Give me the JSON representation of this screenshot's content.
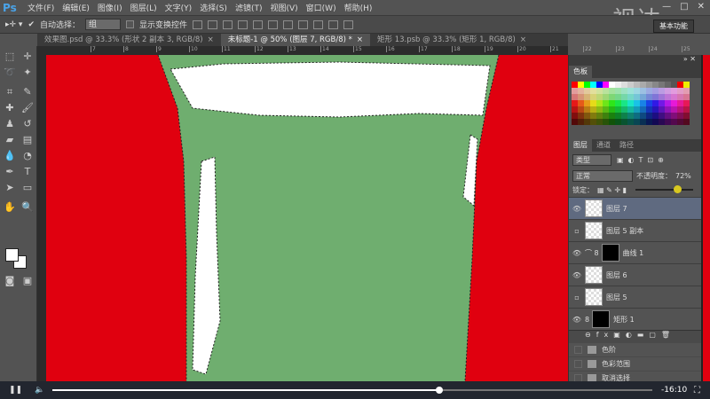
{
  "app": {
    "logo": "Ps",
    "watermark": "视达",
    "window_controls": [
      "—",
      "□",
      "✕"
    ]
  },
  "menu": [
    "文件(F)",
    "编辑(E)",
    "图像(I)",
    "图层(L)",
    "文字(Y)",
    "选择(S)",
    "滤镜(T)",
    "视图(V)",
    "窗口(W)",
    "帮助(H)"
  ],
  "options": {
    "auto_select_label": "自动选择：",
    "auto_select_value": "组",
    "show_transform_label": "显示变换控件",
    "workspace": "基本功能"
  },
  "tabs": [
    {
      "label": "效果图.psd @ 33.3% (形状 2 副本 3, RGB/8)",
      "close": "×",
      "active": false
    },
    {
      "label": "未标题-1 @ 50% (图层 7, RGB/8) *",
      "close": "×",
      "active": true
    },
    {
      "label": "矩形 13.psb @ 33.3% (矩形 1, RGB/8)",
      "close": "×",
      "active": false
    }
  ],
  "ruler": [
    "7",
    "8",
    "9",
    "10",
    "11",
    "12",
    "13",
    "14",
    "15",
    "16",
    "17",
    "18",
    "19",
    "20",
    "21",
    "22",
    "23",
    "24",
    "25"
  ],
  "swatches_panel": {
    "title": "色板"
  },
  "layers_panel": {
    "tabs": [
      "图层",
      "通道",
      "路径"
    ],
    "filter": "类型",
    "blend_mode": "正常",
    "opacity_label": "不透明度：",
    "opacity_value": "72%",
    "opacity_fraction": 0.72,
    "lock_label": "锁定：",
    "layers": [
      {
        "name": "图层 7",
        "visible": true,
        "selected": true
      },
      {
        "name": "图层 5 副本",
        "visible": false,
        "selected": false
      },
      {
        "name": "曲线 1",
        "visible": true,
        "selected": false
      },
      {
        "name": "图层 6",
        "visible": true,
        "selected": false
      },
      {
        "name": "图层 5",
        "visible": false,
        "selected": false
      },
      {
        "name": "矩形 1",
        "visible": true,
        "selected": false
      }
    ]
  },
  "history": [
    "色阶",
    "色彩范围",
    "取消选择"
  ],
  "video": {
    "time": "-16:10",
    "progress": 0.645
  }
}
